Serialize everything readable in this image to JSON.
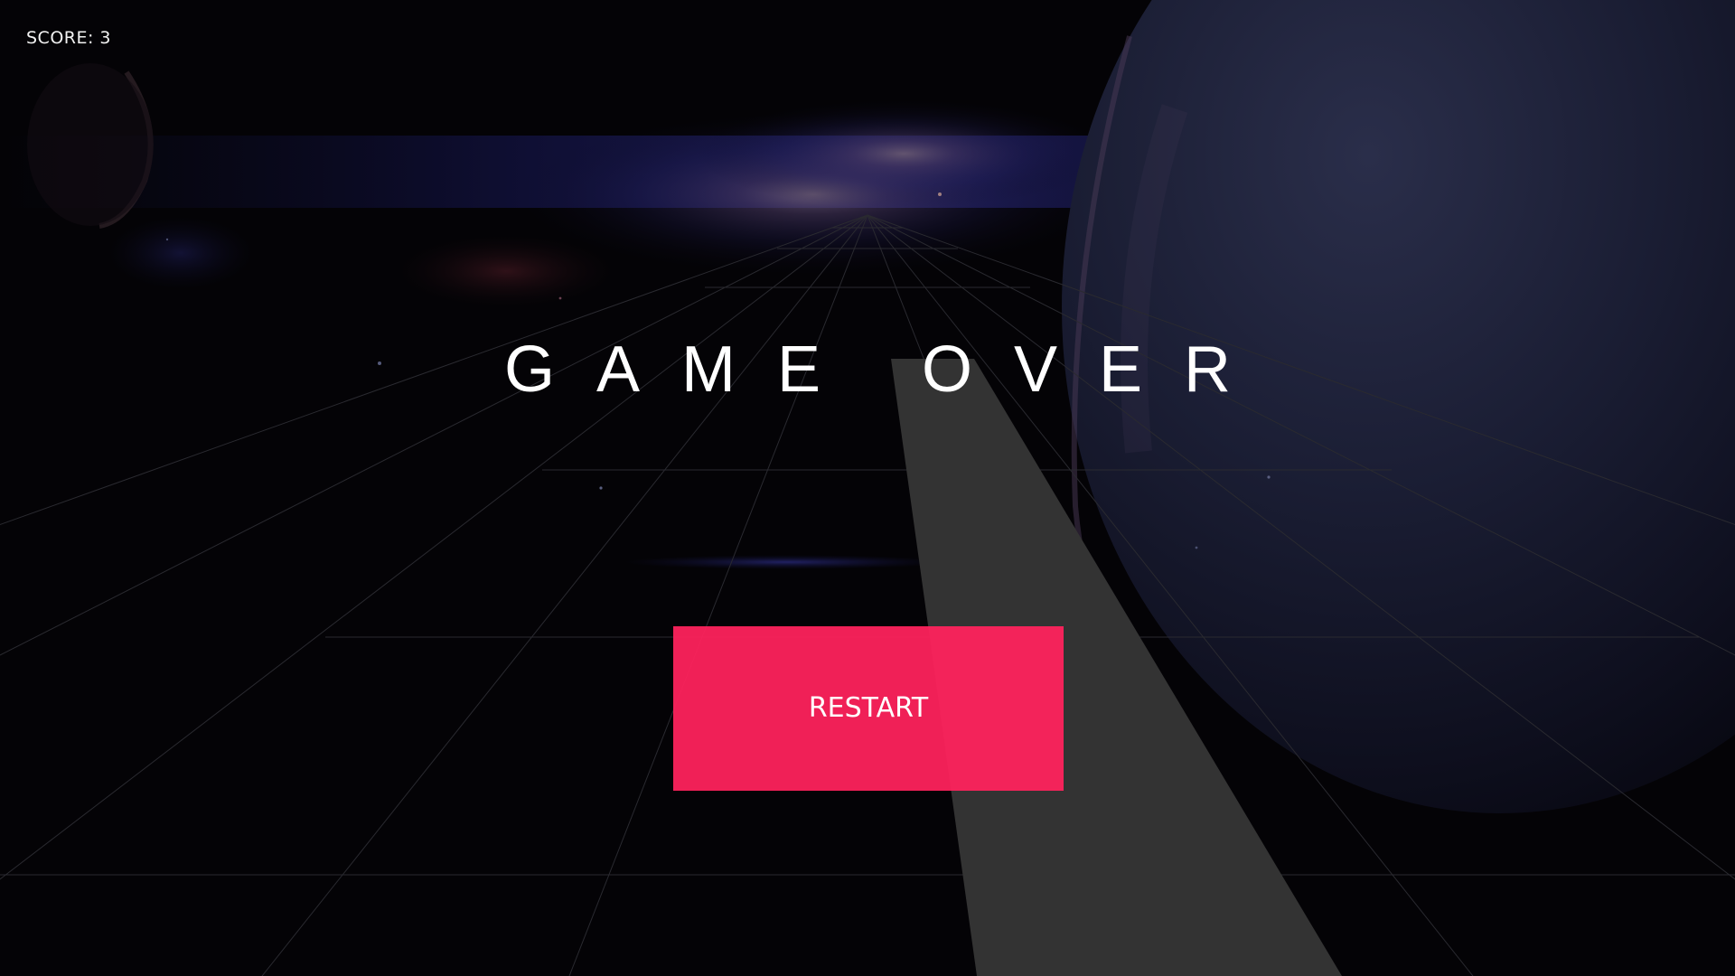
{
  "hud": {
    "score_text": "SCORE: 3"
  },
  "game_over": {
    "title": "GAME OVER",
    "restart_label": "RESTART"
  },
  "colors": {
    "restart_button": "#ff225c",
    "track": "#333333",
    "background": "#040306",
    "text": "#ffffff"
  }
}
